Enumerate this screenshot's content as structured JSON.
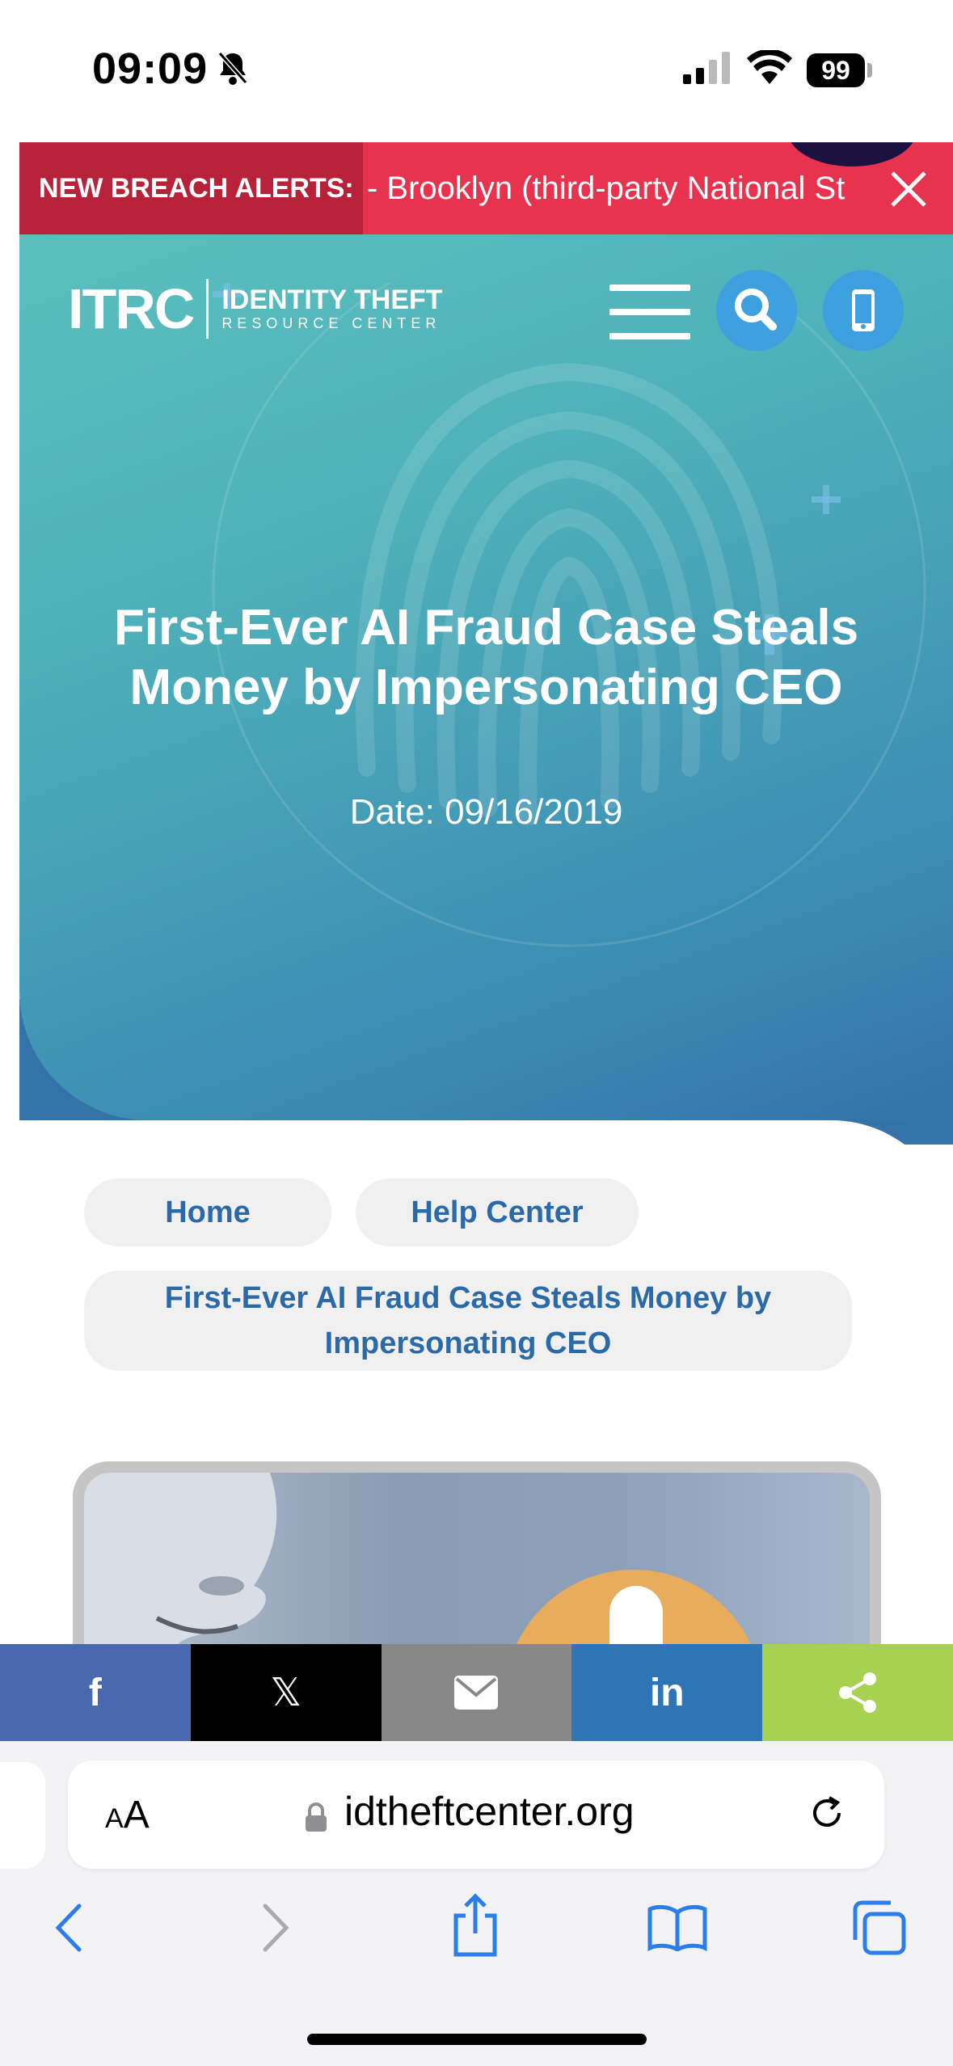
{
  "status_bar": {
    "time": "09:09",
    "battery": "99"
  },
  "alert_bar": {
    "label": "NEW BREACH ALERTS:",
    "ticker": "- Brooklyn (third-party National St"
  },
  "header": {
    "logo_mark": "ITRC",
    "logo_line1": "IDENTITY THEFT",
    "logo_line2": "RESOURCE CENTER"
  },
  "hero": {
    "title": "First-Ever AI Fraud Case Steals Money by Impersonating CEO",
    "date": "Date: 09/16/2019"
  },
  "breadcrumbs": {
    "home": "Home",
    "help_center": "Help Center",
    "current": "First-Ever AI Fraud Case Steals Money by Impersonating CEO"
  },
  "share_bar": {
    "facebook": "f",
    "x": "𝕏",
    "linkedin": "in"
  },
  "browser": {
    "aa_small": "A",
    "aa_large": "A",
    "url": "idtheftcenter.org"
  },
  "colors": {
    "alert_bg": "#e8334f",
    "alert_label_bg": "#b7223a",
    "hero_start": "#5bbfbe",
    "hero_end": "#3473a9",
    "link_blue": "#2a6aa8",
    "facebook": "#4a68b0",
    "mail": "#888888",
    "linkedin": "#2f75b5",
    "share": "#a7d150"
  }
}
